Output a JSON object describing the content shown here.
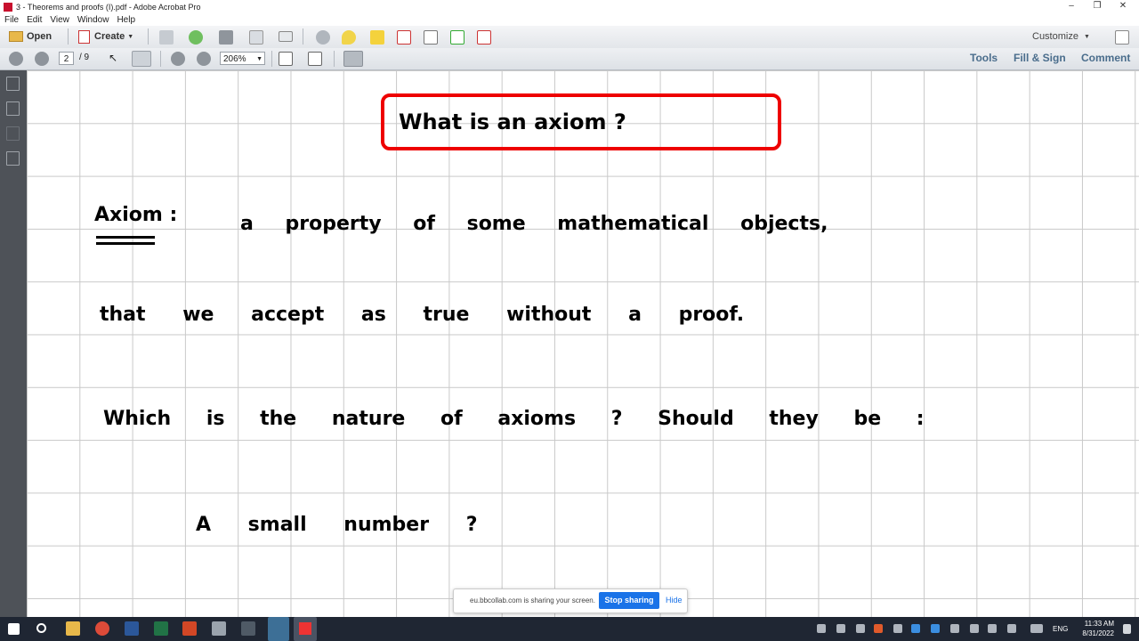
{
  "window": {
    "title": "3 - Theorems and proofs (I).pdf - Adobe Acrobat Pro",
    "minimize": "–",
    "restore": "❐",
    "close": "✕"
  },
  "menu": {
    "file": "File",
    "edit": "Edit",
    "view": "View",
    "window": "Window",
    "help": "Help"
  },
  "toolbar": {
    "open": "Open",
    "create": "Create",
    "customize": "Customize"
  },
  "nav": {
    "page_current": "2",
    "page_total": "/ 9",
    "zoom": "206%"
  },
  "right_links": {
    "tools": "Tools",
    "fill_sign": "Fill & Sign",
    "comment": "Comment"
  },
  "document": {
    "heading": "What   is   an   axiom ?",
    "axiom_label": "Axiom :",
    "line1": "a   property   of   some   mathematical   objects,",
    "line2": "that   we   accept   as   true   without   a   proof.",
    "line3": "Which   is   the   nature   of   axioms ?   Should   they   be :",
    "line4": "A   small   number ?"
  },
  "share_bar": {
    "message": "eu.bbcollab.com is sharing your screen.",
    "stop": "Stop sharing",
    "hide": "Hide"
  },
  "taskbar": {
    "lang": "ENG",
    "time": "11:33 AM",
    "date": "8/31/2022"
  },
  "colors": {
    "heading_box": "#e00000",
    "link": "#4a6d8c",
    "taskbar": "#1f2633",
    "stop_button": "#1a73e8"
  }
}
